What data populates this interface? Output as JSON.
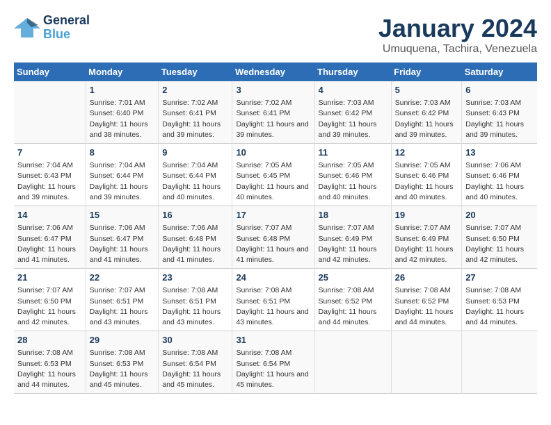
{
  "header": {
    "logo_general": "General",
    "logo_blue": "Blue",
    "title": "January 2024",
    "location": "Umuquena, Tachira, Venezuela"
  },
  "days_of_week": [
    "Sunday",
    "Monday",
    "Tuesday",
    "Wednesday",
    "Thursday",
    "Friday",
    "Saturday"
  ],
  "weeks": [
    [
      {
        "day": "",
        "sunrise": "",
        "sunset": "",
        "daylight": ""
      },
      {
        "day": "1",
        "sunrise": "Sunrise: 7:01 AM",
        "sunset": "Sunset: 6:40 PM",
        "daylight": "Daylight: 11 hours and 38 minutes."
      },
      {
        "day": "2",
        "sunrise": "Sunrise: 7:02 AM",
        "sunset": "Sunset: 6:41 PM",
        "daylight": "Daylight: 11 hours and 39 minutes."
      },
      {
        "day": "3",
        "sunrise": "Sunrise: 7:02 AM",
        "sunset": "Sunset: 6:41 PM",
        "daylight": "Daylight: 11 hours and 39 minutes."
      },
      {
        "day": "4",
        "sunrise": "Sunrise: 7:03 AM",
        "sunset": "Sunset: 6:42 PM",
        "daylight": "Daylight: 11 hours and 39 minutes."
      },
      {
        "day": "5",
        "sunrise": "Sunrise: 7:03 AM",
        "sunset": "Sunset: 6:42 PM",
        "daylight": "Daylight: 11 hours and 39 minutes."
      },
      {
        "day": "6",
        "sunrise": "Sunrise: 7:03 AM",
        "sunset": "Sunset: 6:43 PM",
        "daylight": "Daylight: 11 hours and 39 minutes."
      }
    ],
    [
      {
        "day": "7",
        "sunrise": "Sunrise: 7:04 AM",
        "sunset": "Sunset: 6:43 PM",
        "daylight": "Daylight: 11 hours and 39 minutes."
      },
      {
        "day": "8",
        "sunrise": "Sunrise: 7:04 AM",
        "sunset": "Sunset: 6:44 PM",
        "daylight": "Daylight: 11 hours and 39 minutes."
      },
      {
        "day": "9",
        "sunrise": "Sunrise: 7:04 AM",
        "sunset": "Sunset: 6:44 PM",
        "daylight": "Daylight: 11 hours and 40 minutes."
      },
      {
        "day": "10",
        "sunrise": "Sunrise: 7:05 AM",
        "sunset": "Sunset: 6:45 PM",
        "daylight": "Daylight: 11 hours and 40 minutes."
      },
      {
        "day": "11",
        "sunrise": "Sunrise: 7:05 AM",
        "sunset": "Sunset: 6:46 PM",
        "daylight": "Daylight: 11 hours and 40 minutes."
      },
      {
        "day": "12",
        "sunrise": "Sunrise: 7:05 AM",
        "sunset": "Sunset: 6:46 PM",
        "daylight": "Daylight: 11 hours and 40 minutes."
      },
      {
        "day": "13",
        "sunrise": "Sunrise: 7:06 AM",
        "sunset": "Sunset: 6:46 PM",
        "daylight": "Daylight: 11 hours and 40 minutes."
      }
    ],
    [
      {
        "day": "14",
        "sunrise": "Sunrise: 7:06 AM",
        "sunset": "Sunset: 6:47 PM",
        "daylight": "Daylight: 11 hours and 41 minutes."
      },
      {
        "day": "15",
        "sunrise": "Sunrise: 7:06 AM",
        "sunset": "Sunset: 6:47 PM",
        "daylight": "Daylight: 11 hours and 41 minutes."
      },
      {
        "day": "16",
        "sunrise": "Sunrise: 7:06 AM",
        "sunset": "Sunset: 6:48 PM",
        "daylight": "Daylight: 11 hours and 41 minutes."
      },
      {
        "day": "17",
        "sunrise": "Sunrise: 7:07 AM",
        "sunset": "Sunset: 6:48 PM",
        "daylight": "Daylight: 11 hours and 41 minutes."
      },
      {
        "day": "18",
        "sunrise": "Sunrise: 7:07 AM",
        "sunset": "Sunset: 6:49 PM",
        "daylight": "Daylight: 11 hours and 42 minutes."
      },
      {
        "day": "19",
        "sunrise": "Sunrise: 7:07 AM",
        "sunset": "Sunset: 6:49 PM",
        "daylight": "Daylight: 11 hours and 42 minutes."
      },
      {
        "day": "20",
        "sunrise": "Sunrise: 7:07 AM",
        "sunset": "Sunset: 6:50 PM",
        "daylight": "Daylight: 11 hours and 42 minutes."
      }
    ],
    [
      {
        "day": "21",
        "sunrise": "Sunrise: 7:07 AM",
        "sunset": "Sunset: 6:50 PM",
        "daylight": "Daylight: 11 hours and 42 minutes."
      },
      {
        "day": "22",
        "sunrise": "Sunrise: 7:07 AM",
        "sunset": "Sunset: 6:51 PM",
        "daylight": "Daylight: 11 hours and 43 minutes."
      },
      {
        "day": "23",
        "sunrise": "Sunrise: 7:08 AM",
        "sunset": "Sunset: 6:51 PM",
        "daylight": "Daylight: 11 hours and 43 minutes."
      },
      {
        "day": "24",
        "sunrise": "Sunrise: 7:08 AM",
        "sunset": "Sunset: 6:51 PM",
        "daylight": "Daylight: 11 hours and 43 minutes."
      },
      {
        "day": "25",
        "sunrise": "Sunrise: 7:08 AM",
        "sunset": "Sunset: 6:52 PM",
        "daylight": "Daylight: 11 hours and 44 minutes."
      },
      {
        "day": "26",
        "sunrise": "Sunrise: 7:08 AM",
        "sunset": "Sunset: 6:52 PM",
        "daylight": "Daylight: 11 hours and 44 minutes."
      },
      {
        "day": "27",
        "sunrise": "Sunrise: 7:08 AM",
        "sunset": "Sunset: 6:53 PM",
        "daylight": "Daylight: 11 hours and 44 minutes."
      }
    ],
    [
      {
        "day": "28",
        "sunrise": "Sunrise: 7:08 AM",
        "sunset": "Sunset: 6:53 PM",
        "daylight": "Daylight: 11 hours and 44 minutes."
      },
      {
        "day": "29",
        "sunrise": "Sunrise: 7:08 AM",
        "sunset": "Sunset: 6:53 PM",
        "daylight": "Daylight: 11 hours and 45 minutes."
      },
      {
        "day": "30",
        "sunrise": "Sunrise: 7:08 AM",
        "sunset": "Sunset: 6:54 PM",
        "daylight": "Daylight: 11 hours and 45 minutes."
      },
      {
        "day": "31",
        "sunrise": "Sunrise: 7:08 AM",
        "sunset": "Sunset: 6:54 PM",
        "daylight": "Daylight: 11 hours and 45 minutes."
      },
      {
        "day": "",
        "sunrise": "",
        "sunset": "",
        "daylight": ""
      },
      {
        "day": "",
        "sunrise": "",
        "sunset": "",
        "daylight": ""
      },
      {
        "day": "",
        "sunrise": "",
        "sunset": "",
        "daylight": ""
      }
    ]
  ]
}
